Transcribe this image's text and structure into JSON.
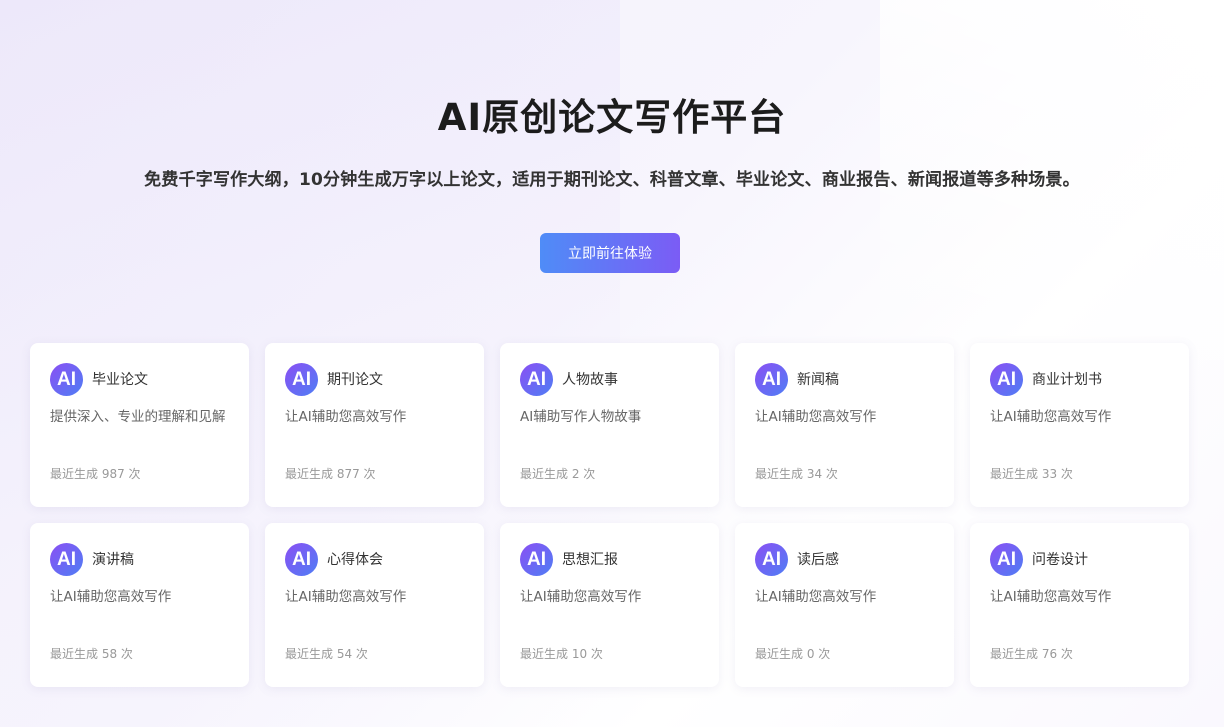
{
  "hero": {
    "title": "AI原创论文写作平台",
    "subtitle": "免费千字写作大纲，10分钟生成万字以上论文，适用于期刊论文、科普文章、毕业论文、商业报告、新闻报道等多种场景。",
    "cta_label": "立即前往体验"
  },
  "cards": [
    {
      "icon_text": "AI",
      "title": "毕业论文",
      "desc": "提供深入、专业的理解和见解",
      "count": "最近生成 987 次"
    },
    {
      "icon_text": "AI",
      "title": "期刊论文",
      "desc": "让AI辅助您高效写作",
      "count": "最近生成 877 次"
    },
    {
      "icon_text": "AI",
      "title": "人物故事",
      "desc": "AI辅助写作人物故事",
      "count": "最近生成 2 次"
    },
    {
      "icon_text": "AI",
      "title": "新闻稿",
      "desc": "让AI辅助您高效写作",
      "count": "最近生成 34 次"
    },
    {
      "icon_text": "AI",
      "title": "商业计划书",
      "desc": "让AI辅助您高效写作",
      "count": "最近生成 33 次"
    },
    {
      "icon_text": "AI",
      "title": "演讲稿",
      "desc": "让AI辅助您高效写作",
      "count": "最近生成 58 次"
    },
    {
      "icon_text": "AI",
      "title": "心得体会",
      "desc": "让AI辅助您高效写作",
      "count": "最近生成 54 次"
    },
    {
      "icon_text": "AI",
      "title": "思想汇报",
      "desc": "让AI辅助您高效写作",
      "count": "最近生成 10 次"
    },
    {
      "icon_text": "AI",
      "title": "读后感",
      "desc": "让AI辅助您高效写作",
      "count": "最近生成 0 次"
    },
    {
      "icon_text": "AI",
      "title": "问卷设计",
      "desc": "让AI辅助您高效写作",
      "count": "最近生成 76 次"
    }
  ],
  "colors": {
    "accent_start": "#4f8cf7",
    "accent_end": "#7b5cf5",
    "icon_start": "#8a4ff3",
    "icon_end": "#4f7ef5"
  }
}
